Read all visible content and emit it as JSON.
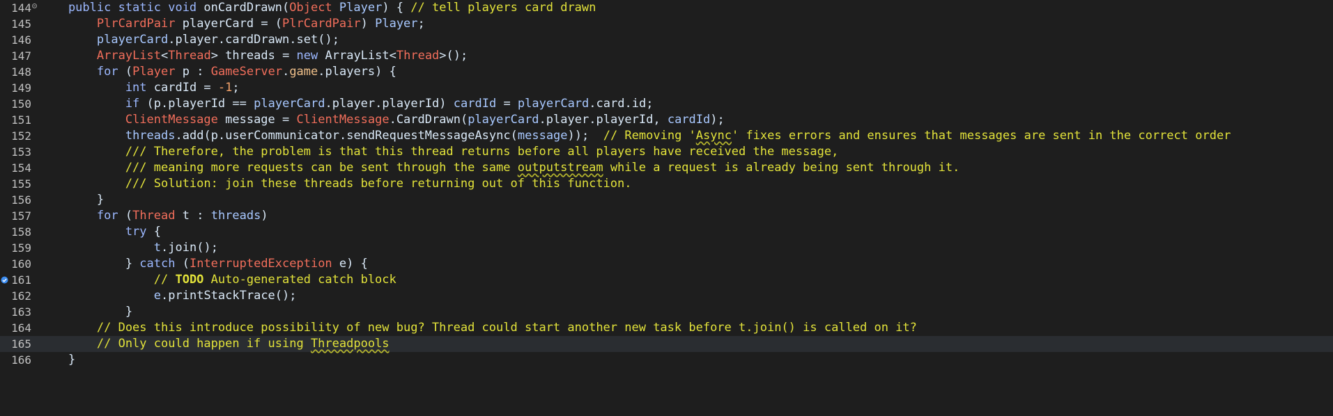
{
  "editor": {
    "current_line_number": "165",
    "lines": [
      {
        "number": "144",
        "text": "    public static void onCardDrawn(Object Player) { // tell players card drawn"
      },
      {
        "number": "145",
        "text": "        PlrCardPair playerCard = (PlrCardPair) Player;"
      },
      {
        "number": "146",
        "text": "        playerCard.player.cardDrawn.set();"
      },
      {
        "number": "147",
        "text": "        ArrayList<Thread> threads = new ArrayList<Thread>();"
      },
      {
        "number": "148",
        "text": "        for (Player p : GameServer.game.players) {"
      },
      {
        "number": "149",
        "text": "            int cardId = -1;"
      },
      {
        "number": "150",
        "text": "            if (p.playerId == playerCard.player.playerId) cardId = playerCard.card.id;"
      },
      {
        "number": "151",
        "text": "            ClientMessage message = ClientMessage.CardDrawn(playerCard.player.playerId, cardId);"
      },
      {
        "number": "152",
        "text": "            threads.add(p.userCommunicator.sendRequestMessageAsync(message));  // Removing 'Async' fixes errors and ensures that messages are sent in the correct order"
      },
      {
        "number": "153",
        "text": "            /// Therefore, the problem is that this thread returns before all players have received the message,"
      },
      {
        "number": "154",
        "text": "            /// meaning more requests can be sent through the same outputstream while a request is already being sent through it."
      },
      {
        "number": "155",
        "text": "            /// Solution: join these threads before returning out of this function."
      },
      {
        "number": "156",
        "text": "        }"
      },
      {
        "number": "157",
        "text": "        for (Thread t : threads)"
      },
      {
        "number": "158",
        "text": "            try {"
      },
      {
        "number": "159",
        "text": "                t.join();"
      },
      {
        "number": "160",
        "text": "            } catch (InterruptedException e) {"
      },
      {
        "number": "161",
        "text": "                // TODO Auto-generated catch block"
      },
      {
        "number": "162",
        "text": "                e.printStackTrace();"
      },
      {
        "number": "163",
        "text": "            }"
      },
      {
        "number": "164",
        "text": "        // Does this introduce possibility of new bug? Thread could start another new task before t.join() is called on it?"
      },
      {
        "number": "165",
        "text": "        // Only could happen if using Threadpools"
      },
      {
        "number": "166",
        "text": "    }"
      }
    ]
  },
  "colors": {
    "background": "#1e1e1e",
    "current_line": "#2a2d31",
    "keyword": "#9cb8ff",
    "type": "#f16e5b",
    "comment": "#e2e23a",
    "identifier": "#d9e8f7",
    "field": "#a8c8ff",
    "number": "#f4a26a",
    "override_marker": "#3b8cf0"
  },
  "icons": {
    "fold_marker": "fold-collapse-icon",
    "override_marker": "override-indicator-icon"
  }
}
